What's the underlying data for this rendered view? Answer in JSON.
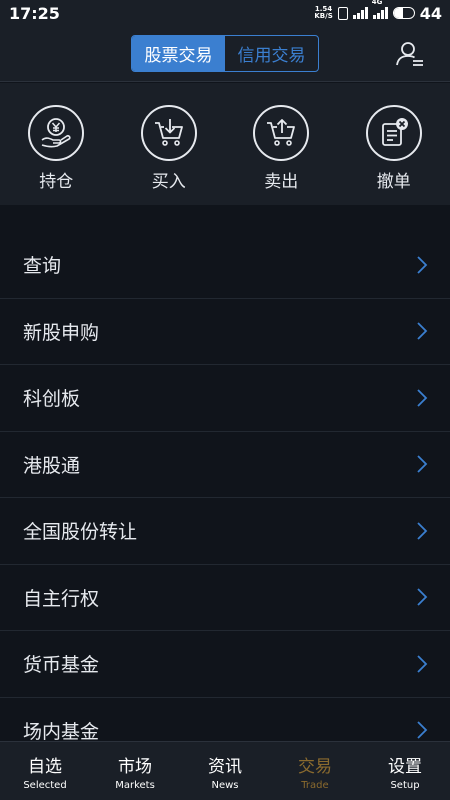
{
  "status_bar": {
    "time": "17:25",
    "net_speed_value": "1.54",
    "net_speed_unit": "KB/S",
    "network_label": "4G",
    "battery": "44",
    "battery_level": 0.44
  },
  "header": {
    "tabs": [
      {
        "label": "股票交易",
        "active": true
      },
      {
        "label": "信用交易",
        "active": false
      }
    ],
    "user_icon": "user-settings-icon"
  },
  "actions": [
    {
      "label": "持仓",
      "icon": "yuan-hand-icon"
    },
    {
      "label": "买入",
      "icon": "cart-in-icon"
    },
    {
      "label": "卖出",
      "icon": "cart-out-icon"
    },
    {
      "label": "撤单",
      "icon": "cancel-order-icon"
    }
  ],
  "menu": [
    {
      "label": "查询"
    },
    {
      "label": "新股申购"
    },
    {
      "label": "科创板"
    },
    {
      "label": "港股通"
    },
    {
      "label": "全国股份转让"
    },
    {
      "label": "自主行权"
    },
    {
      "label": "货币基金"
    },
    {
      "label": "场内基金"
    }
  ],
  "bottom_nav": [
    {
      "zh": "自选",
      "en": "Selected",
      "active": false
    },
    {
      "zh": "市场",
      "en": "Markets",
      "active": false
    },
    {
      "zh": "资讯",
      "en": "News",
      "active": false
    },
    {
      "zh": "交易",
      "en": "Trade",
      "active": true
    },
    {
      "zh": "设置",
      "en": "Setup",
      "active": false
    }
  ],
  "colors": {
    "accent": "#3b7fd0",
    "active_nav": "#8a6a2e",
    "background": "#10141b",
    "panel": "#1a1f27"
  }
}
